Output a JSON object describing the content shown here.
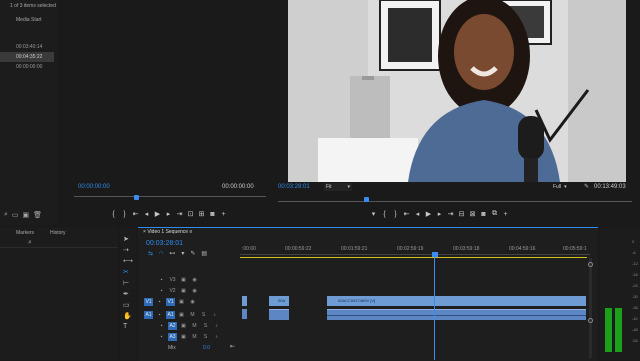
{
  "project": {
    "selection_status": "1 of 3 items selected",
    "column_header": "Media Start",
    "media_starts": [
      "00:03:40:14",
      "00:04:35:22",
      "00:00:00:00"
    ]
  },
  "source_monitor": {
    "timecode": "00:00:00:00",
    "duration": "00:00:00:00"
  },
  "program_monitor": {
    "timecode": "00:03:28:01",
    "zoom": "Fit",
    "quality": "Full",
    "duration": "00:13:49:03"
  },
  "lower_left_tabs": [
    "Markers",
    "History"
  ],
  "sequence": {
    "tab_label": "Video 1 Sequence",
    "timecode": "00:03:28:01",
    "ruler_labels": [
      ":00:00",
      "00:00:59:22",
      "00:01:59:21",
      "00:02:59:19",
      "00:03:59:18",
      "00:04:59:16",
      "00:05:59:1"
    ],
    "video_tracks": [
      "V3",
      "V2",
      "V1"
    ],
    "audio_tracks": [
      "A1",
      "A2",
      "A3"
    ],
    "source_patch_v": "V1",
    "source_patch_a": "A1",
    "mix_label": "Mix",
    "mix_value": "0.0",
    "clips": {
      "v1_short": "00A",
      "v1_long": "00ACC0017469V [V]"
    }
  },
  "meter_labels": [
    "0",
    "-6",
    "-12",
    "-18",
    "-24",
    "-30",
    "-36",
    "-42",
    "-48",
    "-54"
  ],
  "audio_meter": {
    "left_level": 0.42,
    "right_level": 0.42
  },
  "colors": {
    "accent": "#2d8ceb",
    "clip_video": "#6e9bd4",
    "clip_audio": "#5c86c4",
    "playhead": "#3a8cf0",
    "meter": "#1aa01a",
    "workarea": "#d4c31d"
  }
}
